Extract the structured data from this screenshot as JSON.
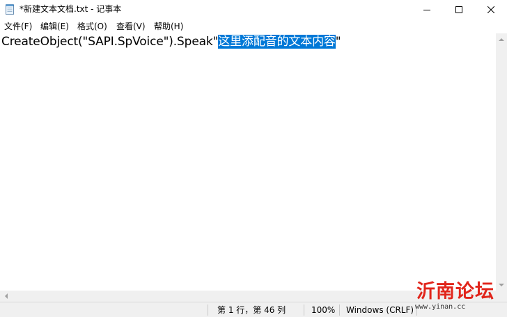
{
  "window": {
    "title": "*新建文本文档.txt - 记事本",
    "icon": "notepad-icon",
    "controls": [
      "minimize-icon",
      "maximize-icon",
      "close-icon"
    ]
  },
  "menu": {
    "file": "文件(F)",
    "edit": "编辑(E)",
    "format": "格式(O)",
    "view": "查看(V)",
    "help": "帮助(H)"
  },
  "editor": {
    "text_before": "CreateObject(\"SAPI.SpVoice\").Speak\"",
    "text_selected": "这里添配音的文本内容",
    "text_after": "\""
  },
  "colors": {
    "selection": "#0078d7",
    "watermark": "#e1251b"
  },
  "status": {
    "position": "第 1 行，第 46 列",
    "zoom": "100%",
    "line_ending": "Windows (CRLF)"
  },
  "watermark": {
    "title": "沂南论坛",
    "url": "www.yinan.cc"
  }
}
